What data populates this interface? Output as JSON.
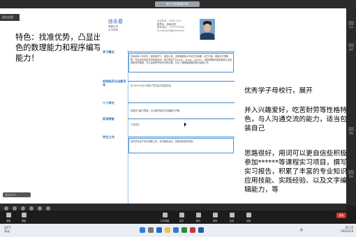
{
  "meeting": {
    "title_pill": "张三正在屏幕共享",
    "top_button": "退出全屏",
    "input_placeholder": "说点什么…",
    "end_label": "结束"
  },
  "annotations": {
    "left": "特色：找准优势，凸显出色的数理能力和程序编写能力！",
    "right_1": "优秀学子母校行，展开",
    "right_2": "并入兴趣爱好，吃苦耐劳等性格特色，与人沟通交流的能力，适当包装自己",
    "right_3": "思路很好，用词可以更自信些积极参加******等课程实习项目，撰写实习报告，积累了丰富的专业知识应用技能、实践经验、以及文字编辑能力，等"
  },
  "resume": {
    "name": "徐永春",
    "school_line": "湖南大学",
    "major_line": "大气科学",
    "info": [
      "出生年月：2000.10.4",
      "籍贯地：湖南邵阳",
      "联系电话：177****1004",
      "E-mail:xyc@gmail.com"
    ],
    "sections": {
      "study": {
        "title": "学习情况",
        "text": "在读本科一年半中，我勤奋学习、刻苦认真，主修课程有大气动力学原理、动力气象、数值天气预报等，专业综合成绩名列年级前列。现已掌握了Fortran，grads，python，c语言等程序语言基础以及常用软件的使用，可以运用所学知识分析问题。负责了课题组数据处理与绘图工作。"
      },
      "practice": {
        "title": "实践经历与志愿活动",
        "text": "在 2019-2020 参加了学生会与志愿活动。"
      },
      "personal": {
        "title": "个人特长",
        "text": "热爱学习能力很强，可以胜任较好文字编辑工作等。"
      },
      "awards": {
        "title": "奖项荣誉",
        "text": "三好学生"
      },
      "work": {
        "title": "学生工作",
        "text": "担任学生会干事与班委工作，负责组织活动，协助完成各项事务。"
      }
    }
  },
  "right_strip": [
    "共享",
    "成员",
    "录制",
    "更多"
  ],
  "meeting_toolbar": [
    "静音",
    "视频",
    "共享屏幕",
    "成员",
    "聊天",
    "录制",
    "应用",
    "设置"
  ],
  "taskbar": {
    "weather_temp": "20°C",
    "weather_desc": "多云",
    "time": "20:15",
    "date": "2022/1/9",
    "tray": "英"
  }
}
